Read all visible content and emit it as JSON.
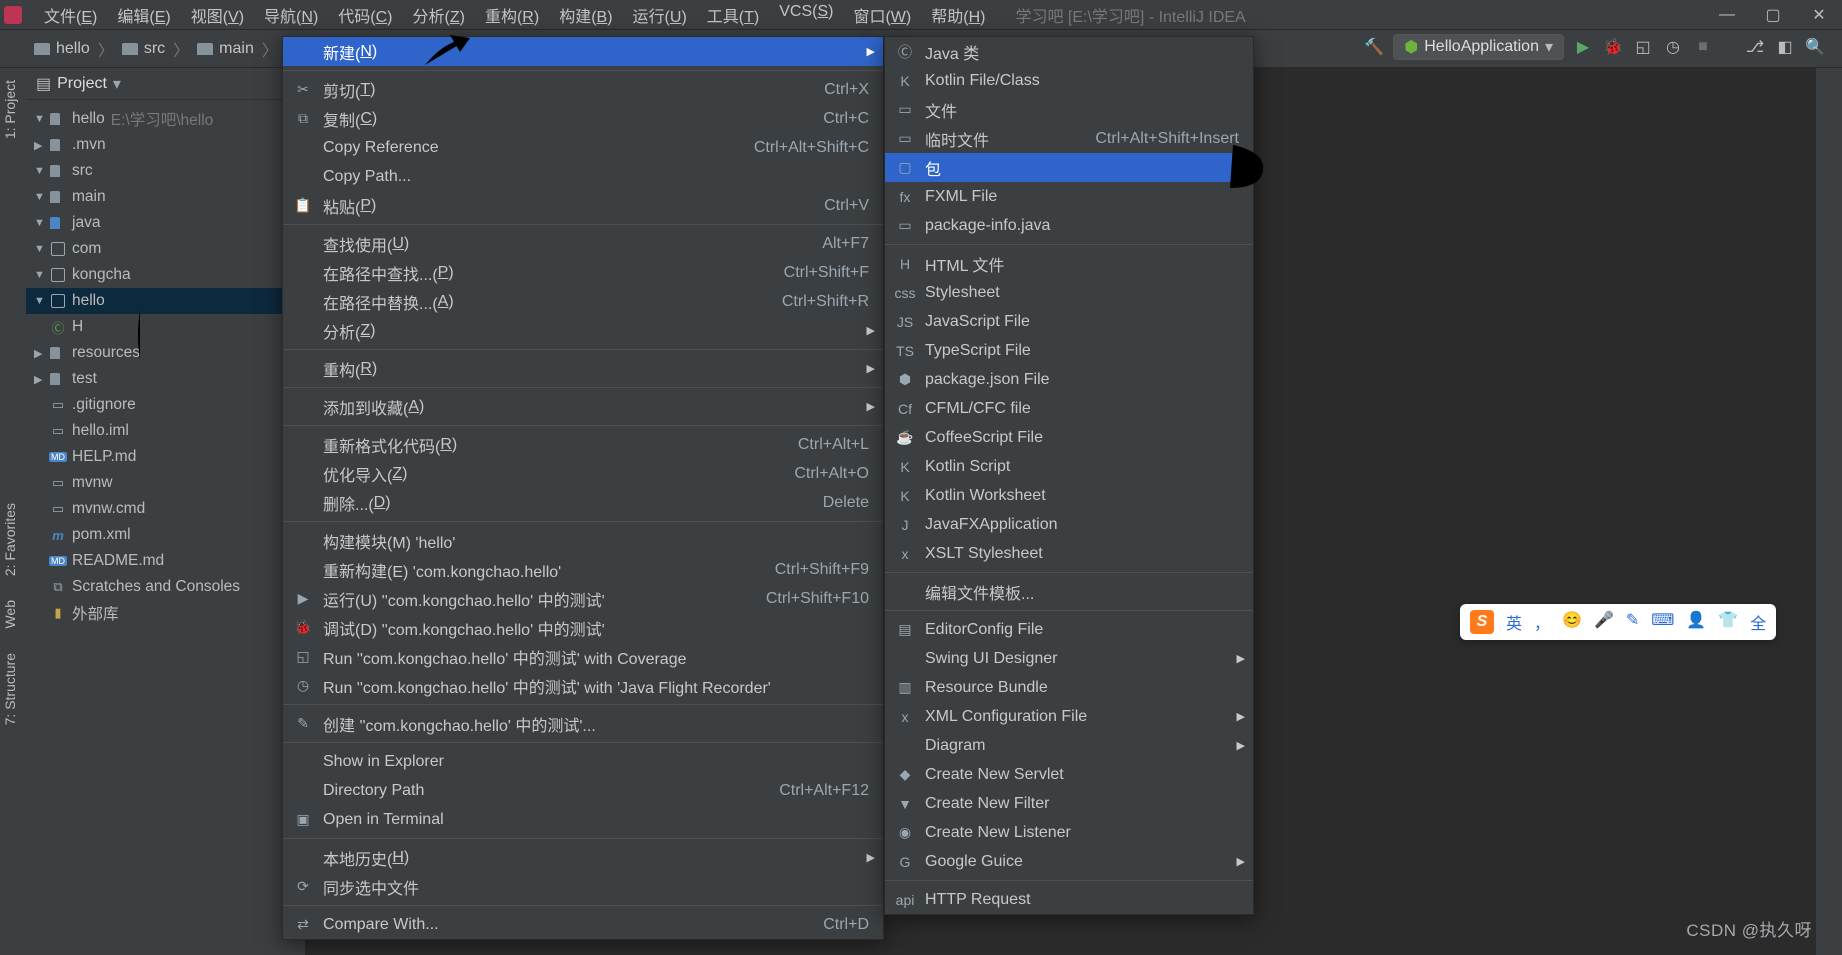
{
  "title_bar": {
    "project_hint": "学习吧 [E:\\学习吧] - IntelliJ IDEA",
    "menus": [
      {
        "t": "文件",
        "k": "E"
      },
      {
        "t": "编辑",
        "k": "E"
      },
      {
        "t": "视图",
        "k": "V"
      },
      {
        "t": "导航",
        "k": "N"
      },
      {
        "t": "代码",
        "k": "C"
      },
      {
        "t": "分析",
        "k": "Z"
      },
      {
        "t": "重构",
        "k": "R"
      },
      {
        "t": "构建",
        "k": "B"
      },
      {
        "t": "运行",
        "k": "U"
      },
      {
        "t": "工具",
        "k": "T"
      },
      {
        "t": "VCS",
        "k": "S"
      },
      {
        "t": "窗口",
        "k": "W"
      },
      {
        "t": "帮助",
        "k": "H"
      }
    ]
  },
  "breadcrumb": [
    "hello",
    "src",
    "main"
  ],
  "run_config": {
    "name": "HelloApplication"
  },
  "side_tabs_left": [
    "1: Project",
    "2: Favorites",
    "Web",
    "7: Structure"
  ],
  "project_header": "Project",
  "tree": [
    {
      "d": 0,
      "c": "down",
      "icon": "folder",
      "label": "hello",
      "dim": "E:\\学习吧\\hello"
    },
    {
      "d": 1,
      "c": "right",
      "icon": "folder",
      "label": ".mvn"
    },
    {
      "d": 1,
      "c": "down",
      "icon": "folder",
      "label": "src"
    },
    {
      "d": 2,
      "c": "down",
      "icon": "folder",
      "label": "main"
    },
    {
      "d": 3,
      "c": "down",
      "icon": "folder-blue",
      "label": "java"
    },
    {
      "d": 4,
      "c": "down",
      "icon": "pkg",
      "label": "com"
    },
    {
      "d": 5,
      "c": "down",
      "icon": "pkg",
      "label": "kongcha"
    },
    {
      "d": 6,
      "c": "down",
      "icon": "pkg",
      "label": "hello",
      "sel": true
    },
    {
      "d": 7,
      "c": "none",
      "icon": "class",
      "label": "H"
    },
    {
      "d": 3,
      "c": "right",
      "icon": "folder",
      "label": "resources"
    },
    {
      "d": 2,
      "c": "right",
      "icon": "folder",
      "label": "test"
    },
    {
      "d": 1,
      "c": "none",
      "icon": "file",
      "label": ".gitignore"
    },
    {
      "d": 1,
      "c": "none",
      "icon": "file",
      "label": "hello.iml"
    },
    {
      "d": 1,
      "c": "none",
      "icon": "md",
      "label": "HELP.md"
    },
    {
      "d": 1,
      "c": "none",
      "icon": "file",
      "label": "mvnw"
    },
    {
      "d": 1,
      "c": "none",
      "icon": "file",
      "label": "mvnw.cmd"
    },
    {
      "d": 1,
      "c": "none",
      "icon": "maven",
      "label": "pom.xml"
    },
    {
      "d": 1,
      "c": "none",
      "icon": "md",
      "label": "README.md"
    },
    {
      "d": 0,
      "c": "none",
      "icon": "scratch",
      "label": "Scratches and Consoles"
    },
    {
      "d": 0,
      "c": "none",
      "icon": "lib",
      "label": "外部库"
    }
  ],
  "ctx1": [
    {
      "type": "item",
      "icon": "",
      "label": "新建",
      "k": "N",
      "sc": "",
      "sub": true,
      "hl": true
    },
    {
      "type": "sep"
    },
    {
      "type": "item",
      "icon": "cut",
      "label": "剪切",
      "k": "T",
      "sc": "Ctrl+X"
    },
    {
      "type": "item",
      "icon": "copy",
      "label": "复制",
      "k": "C",
      "sc": "Ctrl+C"
    },
    {
      "type": "item",
      "icon": "",
      "label": "Copy Reference",
      "sc": "Ctrl+Alt+Shift+C"
    },
    {
      "type": "item",
      "icon": "",
      "label": "Copy Path..."
    },
    {
      "type": "item",
      "icon": "paste",
      "label": "粘贴",
      "k": "P",
      "sc": "Ctrl+V"
    },
    {
      "type": "sep"
    },
    {
      "type": "item",
      "icon": "",
      "label": "查找使用",
      "k": "U",
      "sc": "Alt+F7"
    },
    {
      "type": "item",
      "icon": "",
      "label": "在路径中查找...",
      "k": "P",
      "sc": "Ctrl+Shift+F"
    },
    {
      "type": "item",
      "icon": "",
      "label": "在路径中替换...",
      "k": "A",
      "sc": "Ctrl+Shift+R"
    },
    {
      "type": "item",
      "icon": "",
      "label": "分析",
      "k": "Z",
      "sub": true
    },
    {
      "type": "sep"
    },
    {
      "type": "item",
      "icon": "",
      "label": "重构",
      "k": "R",
      "sub": true
    },
    {
      "type": "sep"
    },
    {
      "type": "item",
      "icon": "",
      "label": "添加到收藏",
      "k": "A",
      "sub": true
    },
    {
      "type": "sep"
    },
    {
      "type": "item",
      "icon": "",
      "label": "重新格式化代码",
      "k": "R",
      "sc": "Ctrl+Alt+L"
    },
    {
      "type": "item",
      "icon": "",
      "label": "优化导入",
      "k": "Z",
      "sc": "Ctrl+Alt+O"
    },
    {
      "type": "item",
      "icon": "",
      "label": "删除...",
      "k": "D",
      "sc": "Delete"
    },
    {
      "type": "sep"
    },
    {
      "type": "item",
      "icon": "",
      "label": "构建模块(M) 'hello'"
    },
    {
      "type": "item",
      "icon": "",
      "label": "重新构建(E) 'com.kongchao.hello'",
      "sc": "Ctrl+Shift+F9"
    },
    {
      "type": "item",
      "icon": "run",
      "label": "运行(U) ''com.kongchao.hello' 中的测试'",
      "sc": "Ctrl+Shift+F10"
    },
    {
      "type": "item",
      "icon": "debug",
      "label": "调试(D) ''com.kongchao.hello' 中的测试'"
    },
    {
      "type": "item",
      "icon": "cov",
      "label": "Run ''com.kongchao.hello' 中的测试' with Coverage"
    },
    {
      "type": "item",
      "icon": "jfr",
      "label": "Run ''com.kongchao.hello' 中的测试' with 'Java Flight Recorder'"
    },
    {
      "type": "sep"
    },
    {
      "type": "item",
      "icon": "edit",
      "label": "创建 ''com.kongchao.hello' 中的测试'..."
    },
    {
      "type": "sep"
    },
    {
      "type": "item",
      "icon": "",
      "label": "Show in Explorer"
    },
    {
      "type": "item",
      "icon": "",
      "label": "Directory Path",
      "sc": "Ctrl+Alt+F12"
    },
    {
      "type": "item",
      "icon": "term",
      "label": "Open in Terminal"
    },
    {
      "type": "sep"
    },
    {
      "type": "item",
      "icon": "",
      "label": "本地历史",
      "k": "H",
      "sub": true
    },
    {
      "type": "item",
      "icon": "sync",
      "label": "同步选中文件"
    },
    {
      "type": "sep"
    },
    {
      "type": "item",
      "icon": "diff",
      "label": "Compare With...",
      "sc": "Ctrl+D"
    }
  ],
  "ctx2": [
    {
      "type": "item",
      "icon": "c",
      "label": "Java 类"
    },
    {
      "type": "item",
      "icon": "kt",
      "label": "Kotlin File/Class"
    },
    {
      "type": "item",
      "icon": "file",
      "label": "文件"
    },
    {
      "type": "item",
      "icon": "file",
      "label": "临时文件",
      "sc": "Ctrl+Alt+Shift+Insert"
    },
    {
      "type": "item",
      "icon": "pkg",
      "label": "包",
      "hl": true
    },
    {
      "type": "item",
      "icon": "fx",
      "label": "FXML File"
    },
    {
      "type": "item",
      "icon": "file",
      "label": "package-info.java"
    },
    {
      "type": "sep"
    },
    {
      "type": "item",
      "icon": "h",
      "label": "HTML 文件"
    },
    {
      "type": "item",
      "icon": "css",
      "label": "Stylesheet"
    },
    {
      "type": "item",
      "icon": "js",
      "label": "JavaScript File"
    },
    {
      "type": "item",
      "icon": "ts",
      "label": "TypeScript File"
    },
    {
      "type": "item",
      "icon": "npm",
      "label": "package.json File"
    },
    {
      "type": "item",
      "icon": "cf",
      "label": "CFML/CFC file"
    },
    {
      "type": "item",
      "icon": "cof",
      "label": "CoffeeScript File"
    },
    {
      "type": "item",
      "icon": "kt",
      "label": "Kotlin Script"
    },
    {
      "type": "item",
      "icon": "kt",
      "label": "Kotlin Worksheet"
    },
    {
      "type": "item",
      "icon": "j",
      "label": "JavaFXApplication"
    },
    {
      "type": "item",
      "icon": "xsl",
      "label": "XSLT Stylesheet"
    },
    {
      "type": "sep"
    },
    {
      "type": "item",
      "icon": "",
      "label": "编辑文件模板..."
    },
    {
      "type": "sep"
    },
    {
      "type": "item",
      "icon": "ec",
      "label": "EditorConfig File"
    },
    {
      "type": "item",
      "icon": "",
      "label": "Swing UI Designer",
      "sub": true
    },
    {
      "type": "item",
      "icon": "rb",
      "label": "Resource Bundle"
    },
    {
      "type": "item",
      "icon": "xml",
      "label": "XML Configuration File",
      "sub": true
    },
    {
      "type": "item",
      "icon": "",
      "label": "Diagram",
      "sub": true
    },
    {
      "type": "item",
      "icon": "sv",
      "label": "Create New Servlet"
    },
    {
      "type": "item",
      "icon": "fl",
      "label": "Create New Filter"
    },
    {
      "type": "item",
      "icon": "ls",
      "label": "Create New Listener"
    },
    {
      "type": "item",
      "icon": "g",
      "label": "Google Guice",
      "sub": true
    },
    {
      "type": "sep"
    },
    {
      "type": "item",
      "icon": "api",
      "label": "HTTP Request"
    }
  ],
  "ime": {
    "segs": [
      "英",
      "，",
      "😊",
      "🎤",
      "✎",
      "⌨",
      "👤",
      "👕",
      "全"
    ]
  },
  "watermark": "CSDN @执久呀"
}
